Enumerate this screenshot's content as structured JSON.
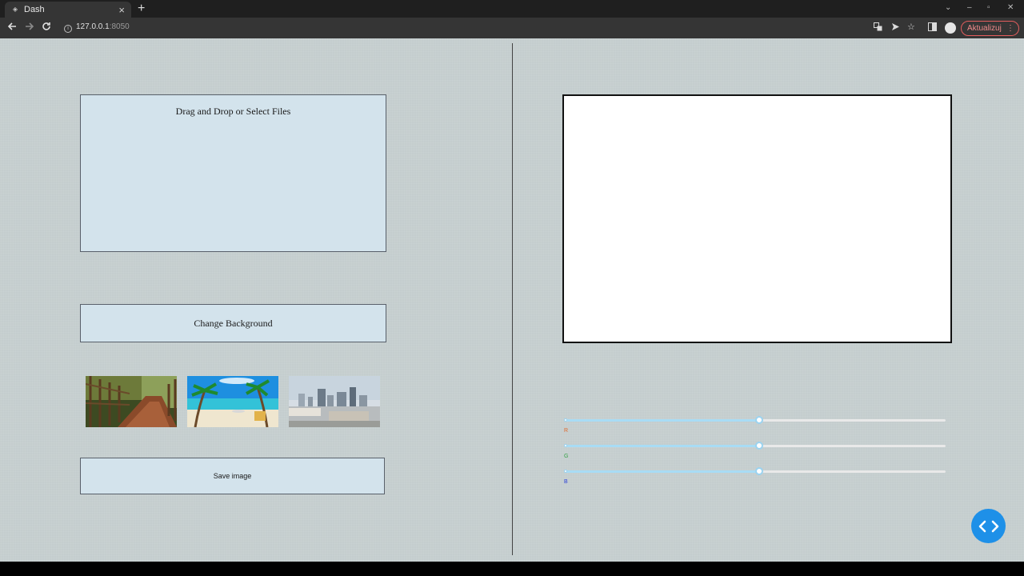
{
  "browser": {
    "tab_title": "Dash",
    "tab_close": "×",
    "new_tab": "+",
    "url_host": "127.0.0.1",
    "url_port": ":8050",
    "update_label": "Aktualizuj",
    "window_controls": [
      "⌄",
      "–",
      "▫",
      "✕"
    ]
  },
  "app": {
    "upload_label": "Drag and Drop or Select Files",
    "change_background_label": "Change Background",
    "save_label": "Save image",
    "backgrounds": [
      "forest-path-thumbnail",
      "tropical-beach-thumbnail",
      "city-skyline-thumbnail"
    ],
    "sliders": [
      {
        "label": "R",
        "value": 0.51,
        "color": "#e06a2c"
      },
      {
        "label": "G",
        "value": 0.51,
        "color": "#3aa44a"
      },
      {
        "label": "B",
        "value": 0.51,
        "color": "#2a3fd6"
      }
    ],
    "colors": {
      "page_bg": "#c4cdce",
      "panel_bg": "#d3e3ec",
      "fab": "#1e90e8",
      "slider_track": "#a8dcf5"
    }
  }
}
